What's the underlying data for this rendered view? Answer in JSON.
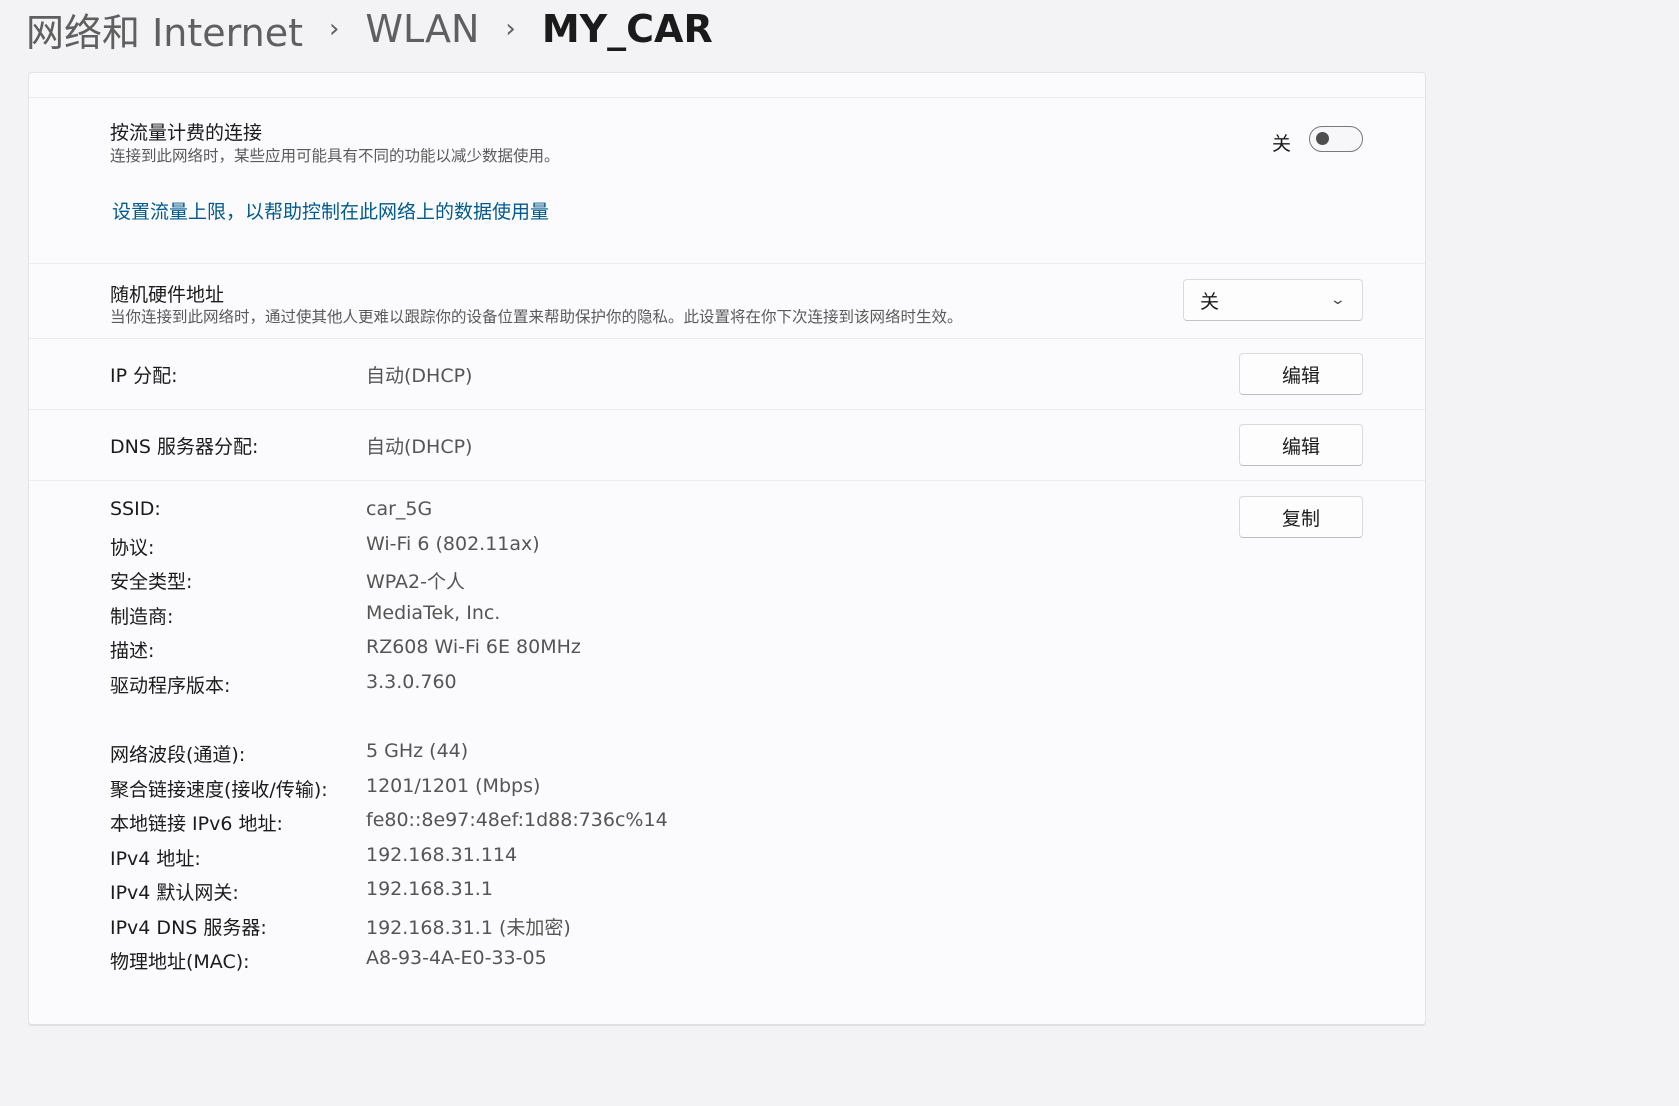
{
  "breadcrumb": {
    "items": [
      "网络和 Internet",
      "WLAN"
    ],
    "separator": "›",
    "current": "MY_CAR"
  },
  "metered": {
    "title": "按流量计费的连接",
    "description": "连接到此网络时，某些应用可能具有不同的功能以减少数据使用。",
    "toggle_label": "关",
    "toggle_on": false,
    "link": "设置流量上限，以帮助控制在此网络上的数据使用量"
  },
  "random_hw": {
    "title": "随机硬件地址",
    "description": "当你连接到此网络时，通过使其他人更难以跟踪你的设备位置来帮助保护你的隐私。此设置将在你下次连接到该网络时生效。",
    "selected": "关"
  },
  "ip_assignment": {
    "label": "IP 分配:",
    "value": "自动(DHCP)",
    "button": "编辑"
  },
  "dns_assignment": {
    "label": "DNS 服务器分配:",
    "value": "自动(DHCP)",
    "button": "编辑"
  },
  "properties": {
    "copy_button": "复制",
    "group1": [
      {
        "label": "SSID:",
        "value": "car_5G"
      },
      {
        "label": "协议:",
        "value": "Wi-Fi 6 (802.11ax)"
      },
      {
        "label": "安全类型:",
        "value": "WPA2-个人"
      },
      {
        "label": "制造商:",
        "value": "MediaTek, Inc."
      },
      {
        "label": "描述:",
        "value": "RZ608 Wi-Fi 6E 80MHz"
      },
      {
        "label": "驱动程序版本:",
        "value": "3.3.0.760"
      }
    ],
    "group2": [
      {
        "label": "网络波段(通道):",
        "value": "5 GHz (44)"
      },
      {
        "label": "聚合链接速度(接收/传输):",
        "value": "1201/1201 (Mbps)"
      },
      {
        "label": "本地链接 IPv6 地址:",
        "value": "fe80::8e97:48ef:1d88:736c%14"
      },
      {
        "label": "IPv4 地址:",
        "value": "192.168.31.114"
      },
      {
        "label": "IPv4 默认网关:",
        "value": "192.168.31.1"
      },
      {
        "label": "IPv4 DNS 服务器:",
        "value": "192.168.31.1 (未加密)"
      },
      {
        "label": "物理地址(MAC):",
        "value": "A8-93-4A-E0-33-05"
      }
    ]
  },
  "colors": {
    "link": "#005a8c",
    "background": "#f3f3f6",
    "panel": "#fbfbfd"
  },
  "icons": {
    "dropdown": "chevron-down-icon",
    "breadcrumb_separator": "chevron-right-icon"
  }
}
